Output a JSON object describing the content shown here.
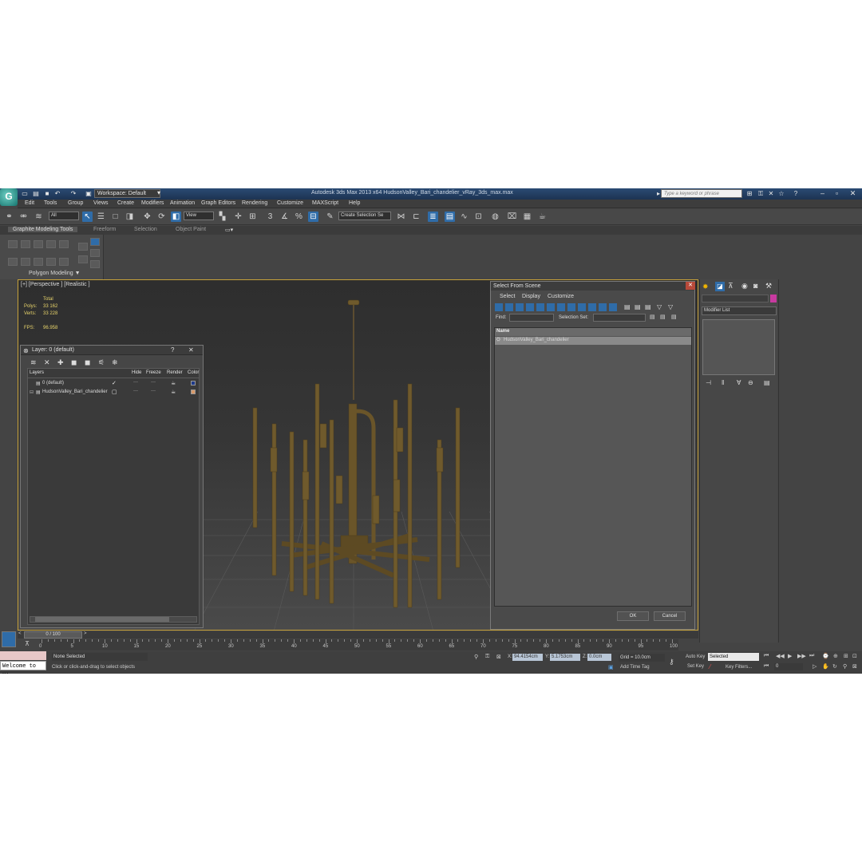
{
  "window": {
    "workspace": "Workspace: Default",
    "title": "Autodesk 3ds Max 2013 x64      HudsonValley_Bari_chandelier_vRay_3ds_max.max",
    "search_placeholder": "Type a keyword or phrase"
  },
  "menu": [
    "Edit",
    "Tools",
    "Group",
    "Views",
    "Create",
    "Modifiers",
    "Animation",
    "Graph Editors",
    "Rendering",
    "Customize",
    "MAXScript",
    "Help"
  ],
  "toolbar": {
    "filter": "All",
    "ref_coord": "View",
    "selection_set": "Create Selection Se"
  },
  "ribbon": {
    "tabs": [
      "Graphite Modeling Tools",
      "Freeform",
      "Selection",
      "Object Paint"
    ],
    "panel_label": "Polygon Modeling ▼"
  },
  "viewport": {
    "label": "[+] [Perspective ] [Realistic ]",
    "stats": {
      "total_label": "Total",
      "polys_label": "Polys:",
      "polys": "33 162",
      "verts_label": "Verts:",
      "verts": "33 228",
      "fps_label": "FPS:",
      "fps": "96.958"
    }
  },
  "layer_dialog": {
    "title": "Layer: 0 (default)",
    "columns": [
      "Layers",
      "Hide",
      "Freeze",
      "Render",
      "Color"
    ],
    "rows": [
      {
        "name": "0 (default)",
        "color": "#1e3a8a"
      },
      {
        "name": "HudsonValley_Bari_chandelier",
        "color": "#d99a6a"
      }
    ]
  },
  "select_from_scene": {
    "title": "Select From Scene",
    "menus": [
      "Select",
      "Display",
      "Customize"
    ],
    "find_label": "Find:",
    "selection_set_label": "Selection Set:",
    "column": "Name",
    "items": [
      "HudsonValley_Bari_chandelier"
    ],
    "ok": "OK",
    "cancel": "Cancel"
  },
  "command_panel": {
    "modifier_list": "Modifier List",
    "color": "#c83aa0"
  },
  "timeline": {
    "frame": "0 / 100",
    "ticks": [
      "0",
      "5",
      "10",
      "15",
      "20",
      "25",
      "30",
      "35",
      "40",
      "45",
      "50",
      "55",
      "60",
      "65",
      "70",
      "75",
      "80",
      "85",
      "90",
      "95",
      "100"
    ]
  },
  "status": {
    "listener": "Welcome to MA",
    "selected": "None Selected",
    "prompt": "Click or click-and-drag to select objects",
    "x_label": "X:",
    "x": "94.4154cm",
    "y_label": "Y:",
    "y": "5.1753cm",
    "z_label": "Z:",
    "z": "0.0cm",
    "grid": "Grid = 10.0cm",
    "add_time_tag": "Add Time Tag",
    "auto_key": "Auto Key",
    "set_key": "Set Key",
    "key_mode": "Selected",
    "key_filters": "Key Filters...",
    "frame_field": "0"
  }
}
